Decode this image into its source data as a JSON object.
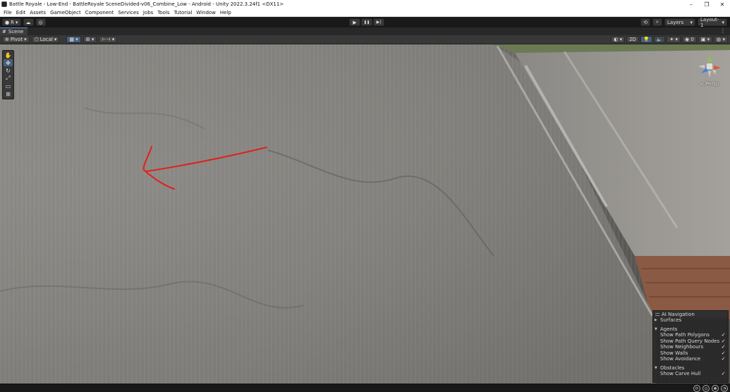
{
  "window": {
    "title": "Battle Royale - Low-End - BattleRoyale SceneDivided-v06_Combine_Low - Android - Unity 2022.3.24f1 <DX11>",
    "minimize_glyph": "–",
    "maximize_glyph": "❐",
    "close_glyph": "✕"
  },
  "menu": {
    "items": [
      "File",
      "Edit",
      "Assets",
      "GameObject",
      "Component",
      "Services",
      "Jobs",
      "Tools",
      "Tutorial",
      "Window",
      "Help"
    ]
  },
  "toolbar": {
    "account_label": "R",
    "account_caret": "▾",
    "cloud_glyph": "☁",
    "collab_glyph": "◎",
    "play_glyph": "▶",
    "pause_glyph": "❚❚",
    "step_glyph": "▶|",
    "history_glyph": "⟲",
    "search_glyph": "⌕",
    "layers_label": "Layers",
    "layout_label": "Layout-1",
    "dropdown_caret": "▾"
  },
  "scene_tab": {
    "label": "Scene",
    "glyph": "#",
    "menu_glyph": "⋮"
  },
  "scene_toolbar": {
    "pivot_label": "Pivot",
    "local_label": "Local",
    "mode_2d_label": "2D"
  },
  "viewport": {
    "view_label": "< Persp",
    "annotation_color": "#e0201c"
  },
  "tools": [
    {
      "name": "hand-tool",
      "glyph": "✋"
    },
    {
      "name": "move-tool",
      "glyph": "✥"
    },
    {
      "name": "rotate-tool",
      "glyph": "↻"
    },
    {
      "name": "scale-tool",
      "glyph": "⤢"
    },
    {
      "name": "rect-tool",
      "glyph": "▭"
    },
    {
      "name": "transform-tool",
      "glyph": "⊞"
    }
  ],
  "ai_navigation": {
    "title": "AI Navigation",
    "surfaces_label": "Surfaces",
    "agents_label": "Agents",
    "agents_options": [
      {
        "label": "Show Path Polygons",
        "checked": true
      },
      {
        "label": "Show Path Query Nodes",
        "checked": true
      },
      {
        "label": "Show Neighbours",
        "checked": true
      },
      {
        "label": "Show Walls",
        "checked": true
      },
      {
        "label": "Show Avoidance",
        "checked": true
      }
    ],
    "obstacles_label": "Obstacles",
    "obstacles_options": [
      {
        "label": "Show Carve Hull",
        "checked": true
      }
    ],
    "check_glyph": "✓",
    "caret_closed": "▶",
    "caret_open": "▼"
  }
}
